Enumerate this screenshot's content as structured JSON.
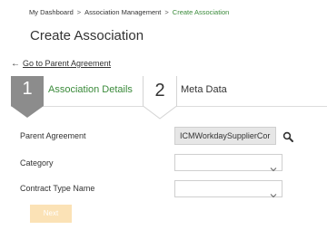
{
  "breadcrumb": {
    "items": [
      "My Dashboard",
      "Association Management",
      "Create Association"
    ],
    "separator": ">"
  },
  "page": {
    "title": "Create Association"
  },
  "back_link": {
    "arrow": "←",
    "label": "Go to Parent Agreement"
  },
  "steps": [
    {
      "number": "1",
      "label": "Association Details",
      "active": true
    },
    {
      "number": "2",
      "label": "Meta Data",
      "active": false
    }
  ],
  "form": {
    "parent_agreement": {
      "label": "Parent Agreement",
      "value": "ICMWorkdaySupplierCor"
    },
    "category": {
      "label": "Category",
      "value": ""
    },
    "contract_type_name": {
      "label": "Contract Type Name",
      "value": ""
    }
  },
  "actions": {
    "next_label": "Next"
  },
  "icons": {
    "search": "search-icon",
    "chevron": "chevron-down-icon",
    "back": "arrow-left-icon"
  },
  "colors": {
    "accent_green": "#3a8a3a",
    "step_active": "#8c8c8c",
    "next_disabled": "#fbe2b6"
  }
}
